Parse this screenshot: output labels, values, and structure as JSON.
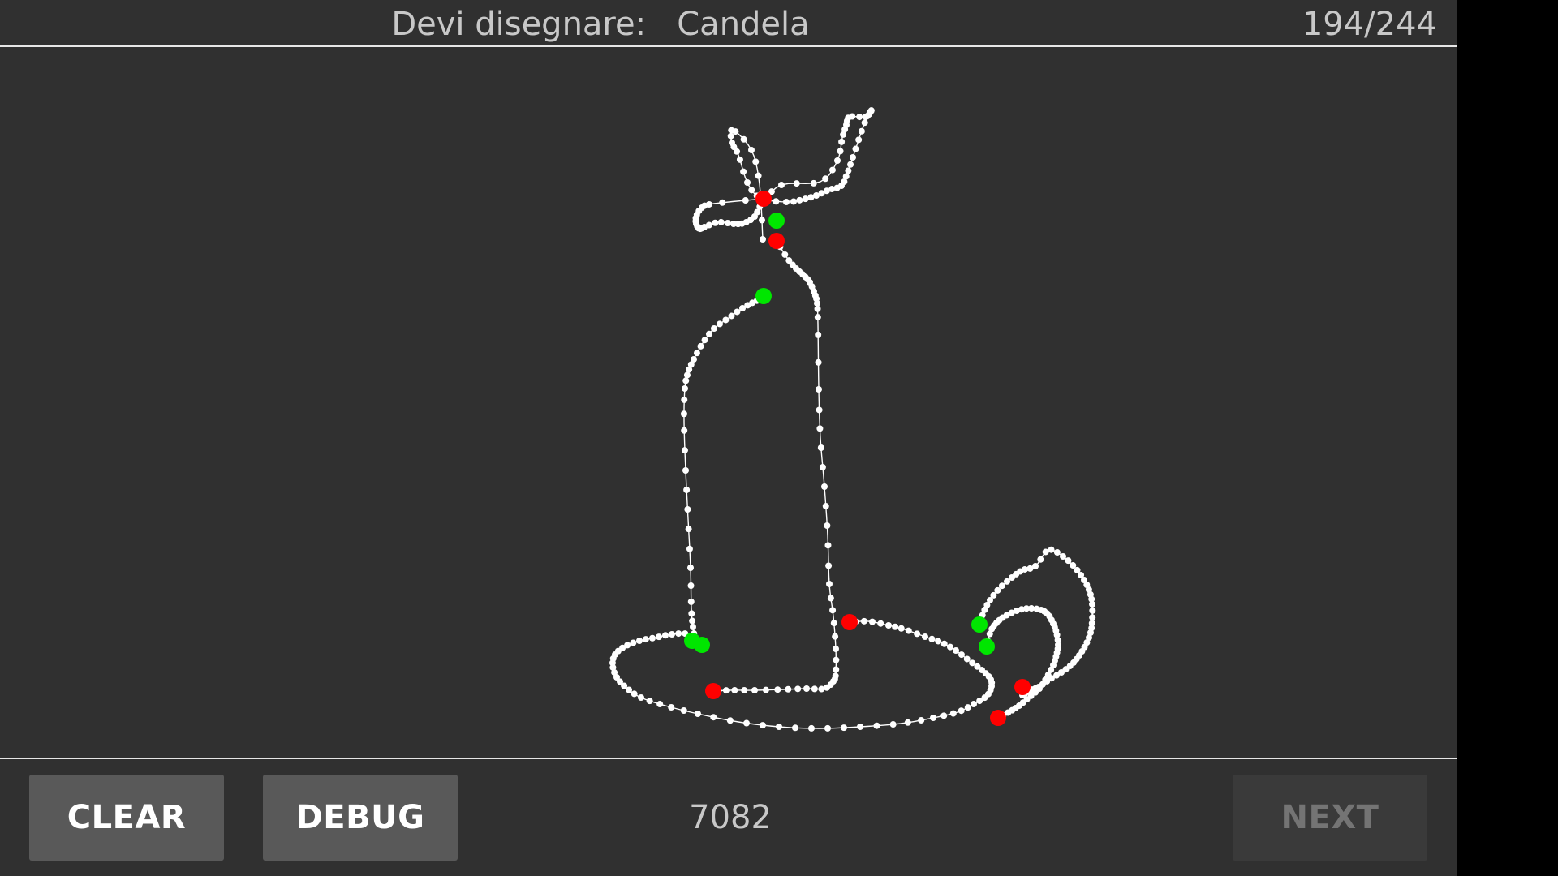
{
  "header": {
    "prompt_label": "Devi disegnare:",
    "word": "Candela",
    "counter": "194/244"
  },
  "footer": {
    "clear_label": "CLEAR",
    "debug_label": "DEBUG",
    "score": "7082",
    "next_label": "NEXT"
  },
  "colors": {
    "background": "#303030",
    "stroke": "#ffffff",
    "start_marker": "#00e600",
    "end_marker": "#ff0000",
    "button": "#595959",
    "button_disabled": "#3a3a3a"
  }
}
